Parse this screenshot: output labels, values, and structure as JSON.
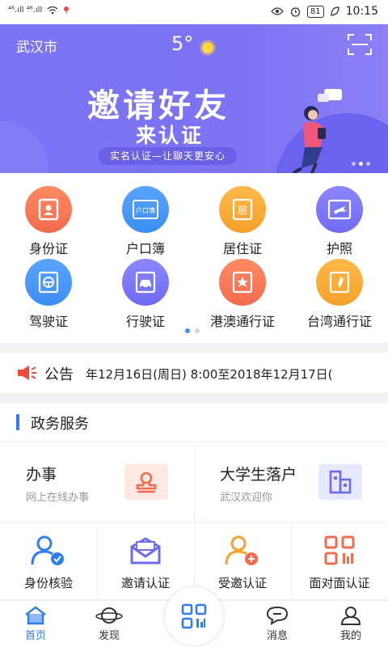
{
  "status_bar": {
    "signal_left": "⁴⁶.ıll ⁴⁶.ıll",
    "battery": "81",
    "time": "10:15"
  },
  "header": {
    "city": "武汉市",
    "temperature": "5°"
  },
  "banner": {
    "title": "邀请好友",
    "subtitle": "来认证",
    "tagline": "实名认证—让聊天更安心",
    "active_dot": 1
  },
  "cards": [
    {
      "label": "身份证",
      "icon": "id-card-icon",
      "color": "#f26b4e"
    },
    {
      "label": "户口簿",
      "icon": "household-register-icon",
      "color": "#3c8ef2",
      "badge": "户口簿"
    },
    {
      "label": "居住证",
      "icon": "residence-permit-icon",
      "color": "#f5a12a",
      "badge": "居"
    },
    {
      "label": "护照",
      "icon": "passport-icon",
      "color": "#6f6af2"
    },
    {
      "label": "驾驶证",
      "icon": "driver-license-icon",
      "color": "#3c8ef2"
    },
    {
      "label": "行驶证",
      "icon": "vehicle-license-icon",
      "color": "#6f6af2"
    },
    {
      "label": "港澳通行证",
      "icon": "hk-macau-pass-icon",
      "color": "#f26b4e"
    },
    {
      "label": "台湾通行证",
      "icon": "taiwan-pass-icon",
      "color": "#f5a12a"
    }
  ],
  "notice": {
    "title": "公告",
    "text": "年12月16日(周日) 8:00至2018年12月17日("
  },
  "services": {
    "heading": "政务服务",
    "big": [
      {
        "title": "办事",
        "subtitle": "网上在线办事",
        "icon": "stamp-icon",
        "bg": "#fde8e2",
        "fg": "#f26b4e"
      },
      {
        "title": "大学生落户",
        "subtitle": "武汉欢迎你",
        "icon": "building-icon",
        "bg": "#e7e9fc",
        "fg": "#6f6af2"
      }
    ],
    "small": [
      {
        "label": "身份核验",
        "icon": "user-check-icon"
      },
      {
        "label": "邀请认证",
        "icon": "invite-envelope-icon"
      },
      {
        "label": "受邀认证",
        "icon": "user-add-icon"
      },
      {
        "label": "面对面认证",
        "icon": "qr-code-icon"
      }
    ]
  },
  "tabs": [
    {
      "label": "首页",
      "icon": "home-icon",
      "active": true
    },
    {
      "label": "发现",
      "icon": "planet-icon",
      "active": false
    },
    {
      "label": "消息",
      "icon": "chat-icon",
      "active": false
    },
    {
      "label": "我的",
      "icon": "profile-icon",
      "active": false
    }
  ]
}
